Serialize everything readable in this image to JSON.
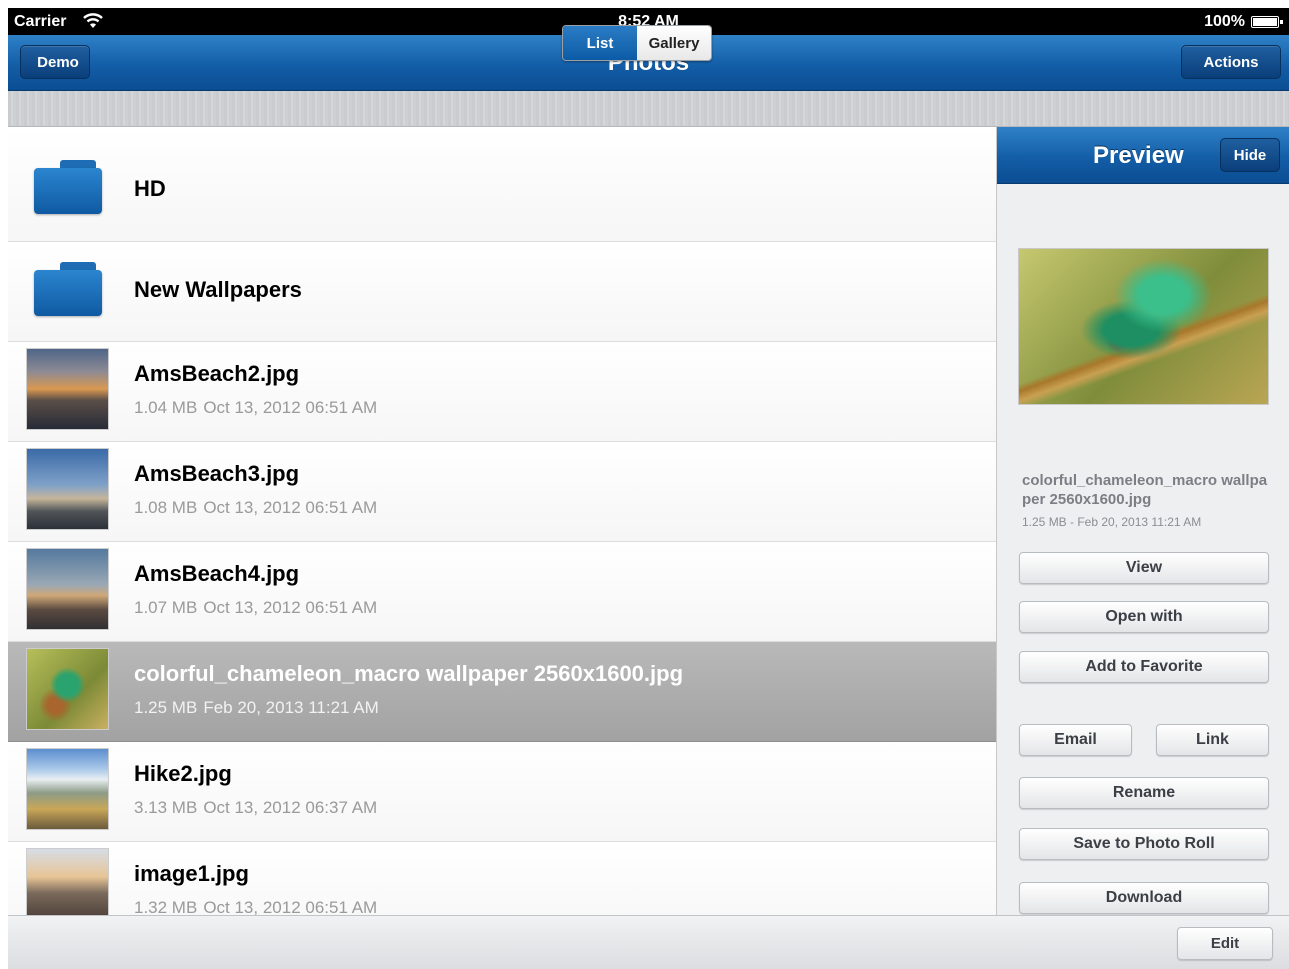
{
  "status_bar": {
    "carrier": "Carrier",
    "time": "8:52 AM",
    "battery": "100%"
  },
  "nav": {
    "back_label": "Demo",
    "title": "Photos",
    "actions_label": "Actions"
  },
  "view_toggle": {
    "selected": "List",
    "options": [
      "List",
      "Gallery"
    ]
  },
  "list": {
    "items": [
      {
        "type": "folder",
        "name": "HD"
      },
      {
        "type": "folder",
        "name": "New Wallpapers"
      },
      {
        "type": "file",
        "name": "AmsBeach2.jpg",
        "size": "1.04 MB",
        "date": "Oct 13, 2012 06:51 AM"
      },
      {
        "type": "file",
        "name": "AmsBeach3.jpg",
        "size": "1.08 MB",
        "date": "Oct 13, 2012 06:51 AM"
      },
      {
        "type": "file",
        "name": "AmsBeach4.jpg",
        "size": "1.07 MB",
        "date": "Oct 13, 2012 06:51 AM"
      },
      {
        "type": "file",
        "name": "colorful_chameleon_macro wallpaper 2560x1600.jpg",
        "size": "1.25 MB",
        "date": "Feb 20, 2013 11:21 AM",
        "selected": true
      },
      {
        "type": "file",
        "name": "Hike2.jpg",
        "size": "3.13 MB",
        "date": "Oct 13, 2012 06:37 AM"
      },
      {
        "type": "file",
        "name": "image1.jpg",
        "size": "1.32 MB",
        "date": "Oct 13, 2012 06:51 AM"
      }
    ]
  },
  "preview": {
    "title": "Preview",
    "hide_label": "Hide",
    "filename": "colorful_chameleon_macro wallpaper 2560x1600.jpg",
    "meta": "1.25 MB - Feb 20, 2013 11:21 AM",
    "buttons": {
      "view": "View",
      "open_with": "Open with",
      "add_favorite": "Add to Favorite",
      "email": "Email",
      "link": "Link",
      "rename": "Rename",
      "save_photo_roll": "Save to Photo Roll",
      "download": "Download"
    }
  },
  "bottom_bar": {
    "edit_label": "Edit"
  },
  "colors": {
    "nav_blue": "#135ea7",
    "folder_blue": "#1e6db4",
    "selected_row": "#a8a8a8"
  }
}
